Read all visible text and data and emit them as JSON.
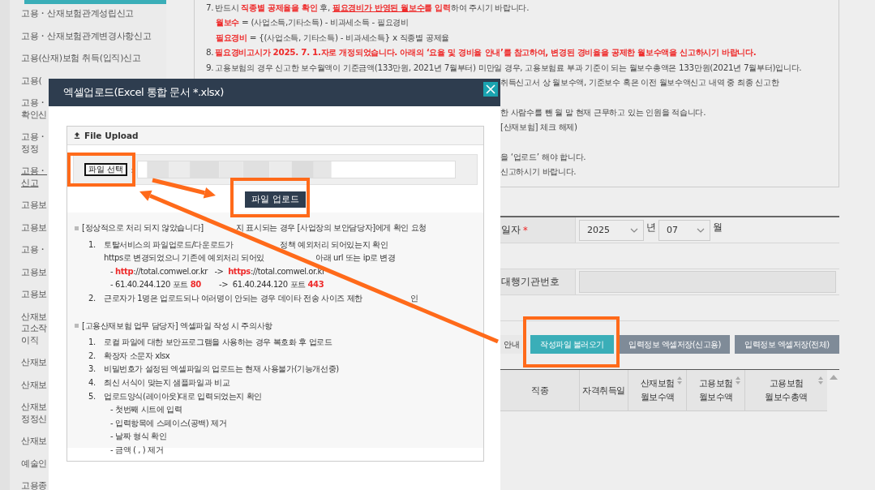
{
  "sidebar": {
    "items": [
      {
        "lines": [
          "고용・산재보험관계성립신고"
        ],
        "selected": false
      },
      {
        "lines": [
          "고용・산재보험관계변경사항신고"
        ],
        "selected": false
      },
      {
        "lines": [
          "고용(산재)보험 취득(입직)신고"
        ],
        "selected": false
      },
      {
        "lines": [
          "고용("
        ],
        "selected": false
      },
      {
        "lines": [
          "고용・",
          "확인신"
        ],
        "selected": false
      },
      {
        "lines": [
          "고용・",
          "정정"
        ],
        "selected": false
      },
      {
        "lines": [
          "고용・",
          "신고"
        ],
        "selected": true
      },
      {
        "lines": [
          "고용보"
        ],
        "selected": false
      },
      {
        "lines": [
          "고용보"
        ],
        "selected": false
      },
      {
        "lines": [
          "고용・"
        ],
        "selected": false
      },
      {
        "lines": [
          "고용보"
        ],
        "selected": false
      },
      {
        "lines": [
          "고용보"
        ],
        "selected": false
      },
      {
        "lines": [
          "산재보",
          "고소작",
          "이직"
        ],
        "selected": false
      },
      {
        "lines": [
          "산재보"
        ],
        "selected": false
      },
      {
        "lines": [
          "산재보"
        ],
        "selected": false
      },
      {
        "lines": [
          "산재보",
          "정정신"
        ],
        "selected": false
      },
      {
        "lines": [
          "산재보"
        ],
        "selected": false
      },
      {
        "lines": [
          "예술인"
        ],
        "selected": false
      },
      {
        "lines": [
          "고용종"
        ],
        "selected": false
      }
    ]
  },
  "notes": [
    {
      "lines": [
        {
          "kind": "item",
          "number": "7.",
          "segments": [
            {
              "text": "반드시 "
            },
            {
              "text": "직종별 공제율을 확인",
              "color": "#ee2b2b"
            },
            {
              "text": " 후, "
            },
            {
              "text": "필요경비가 반영된 월보수",
              "color": "#ee2b2b",
              "underline": true
            },
            {
              "text": "를 입력",
              "color": "#ee2b2b"
            },
            {
              "text": "하여 주시기 바랍니다."
            }
          ]
        },
        {
          "kind": "continuation",
          "segments": [
            {
              "text": "월보수",
              "color": "#ee2b2b"
            },
            {
              "text": " = (사업소득,기타소득) - 비과세소득 - 필요경비"
            }
          ]
        },
        {
          "kind": "continuation",
          "segments": [
            {
              "text": "필요경비",
              "color": "#ee2b2b"
            },
            {
              "text": " = {(사업소득, 기타소득) - 비과세소득} x 직종별 공제율"
            }
          ]
        },
        {
          "kind": "item",
          "number": "8.",
          "segments": [
            {
              "text": "필요경비고시가 2025. 7. 1.자로 개정되었습니다. 아래의 ‘요율 및 경비율 안내’를 참고하여, 변경된 경비율을 공제한 월보수액을 신고하시기 바랍니다.",
              "color": "#ee2b2b"
            }
          ]
        },
        {
          "kind": "item",
          "number": "9.",
          "segments": [
            {
              "text": "고용보험의 경우 신고한 보수월액이 기준금액(133만원, 2021년 7월부터) 미만일 경우, 고용보험료 부과 기준이 되는 월보수총액은 133만원(2021년 7월부터)입니다."
            }
          ]
        },
        {
          "kind": "fragment",
          "segments": [
            {
              "text": "취득신고서 상 월보수액, 기준보수 혹은 이전 월보수액신고 내역 중 최종 신고한"
            }
          ]
        }
      ]
    },
    {
      "lines": [
        {
          "kind": "fragment",
          "segments": [
            {
              "text": "한 사람수를 뺀 월 말 현재 근무하고 있는 인원을 적습니다."
            }
          ]
        },
        {
          "kind": "fragment",
          "segments": [
            {
              "text": "[산재보험] 체크 해제)"
            }
          ]
        }
      ]
    },
    {
      "lines": [
        {
          "kind": "fragment",
          "segments": [
            {
              "text": "을 ‘업로드’ 해야 합니다."
            }
          ]
        },
        {
          "kind": "fragment",
          "segments": [
            {
              "text": "신고하시기 바랍니다."
            }
          ]
        }
      ]
    }
  ],
  "form": {
    "date_row": {
      "label": "일자",
      "required_mark": "*",
      "year": "2025",
      "year_unit": "년",
      "month": "07",
      "month_unit": "월"
    },
    "agency_row": {
      "label": "대행기관번호",
      "disabled": true
    }
  },
  "buttons": [
    {
      "label": "안내",
      "kind": "plain"
    },
    {
      "label": "작성파일 불러오기",
      "kind": "primary"
    },
    {
      "label": "입력정보 엑셀저장(신고용)",
      "kind": "secondary"
    },
    {
      "label": "입력정보 엑셀저장(전체)",
      "kind": "secondary"
    }
  ],
  "table": {
    "columns": [
      {
        "lines": [
          "직종"
        ],
        "sortable": false
      },
      {
        "lines": [
          "자격취득일"
        ],
        "sortable": false
      },
      {
        "lines": [
          "산재보험",
          "월보수액"
        ],
        "sortable": true
      },
      {
        "lines": [
          "고용보험",
          "월보수액"
        ],
        "sortable": true
      },
      {
        "lines": [
          "고용보험",
          "월보수총액"
        ],
        "sortable": true
      }
    ]
  },
  "modal": {
    "title": "엑셀업로드(Excel 통합 문서 *.xlsx)",
    "panel_title": "File Upload",
    "file_button": "파일 선택",
    "separator": ":",
    "upload_button": "파일 업로드",
    "sections": [
      {
        "heading_parts": [
          "[정상적으로 처리 되지 않았습니다]",
          "지 표시되는 경우 [사업장의 보안담당자]에게 확인 요청"
        ],
        "items": [
          {
            "number": "1.",
            "text_parts": [
              "토탈서비스의 파일업로드/다운로드가",
              "정책 예외처리 되어있는지 확인"
            ],
            "sublines": [
              {
                "kind": "continuation",
                "parts": [
                  "https로 변경되었으니 기존에 예외처리 되어있",
                  "아래 url 또는 ip로 변경"
                ]
              },
              {
                "kind": "detail",
                "segments": [
                  {
                    "text": "- "
                  },
                  {
                    "text": "http",
                    "color": "#ee2b2b"
                  },
                  {
                    "text": "://total.comwel.or.kr   ->  "
                  },
                  {
                    "text": "https",
                    "color": "#ee2b2b"
                  },
                  {
                    "text": "://total.comwel.or.kr"
                  }
                ]
              },
              {
                "kind": "detail",
                "segments": [
                  {
                    "text": "- 61.40.244.120 포트 "
                  },
                  {
                    "text": "80",
                    "color": "#ee2b2b"
                  },
                  {
                    "text": "        ->  61.40.244.120 포트 "
                  },
                  {
                    "text": "443",
                    "color": "#ee2b2b"
                  }
                ]
              }
            ]
          },
          {
            "number": "2.",
            "text_parts": [
              "근로자가 1명은 업로드되나 여러명이 안되는 경우 데이타 전송 사이즈 제한",
              "인"
            ]
          }
        ]
      },
      {
        "heading_parts": [
          "[고용산재보험 업무 담당자] 엑셀파일 작성 시 주의사항"
        ],
        "items": [
          {
            "number": "1.",
            "text_parts": [
              "로컬 파일에 대한 보안프로그램을 사용하는 경우 복호화 후 업로드"
            ]
          },
          {
            "number": "2.",
            "text_parts": [
              "확장자 소문자 xlsx"
            ]
          },
          {
            "number": "3.",
            "text_parts": [
              "비밀번호가 설정된 엑셀파일의 업로드는 현재 사용불가(기능개선중)"
            ]
          },
          {
            "number": "4.",
            "text_parts": [
              "최신 서식이 맞는지 샘플파일과 비교"
            ]
          },
          {
            "number": "5.",
            "text_parts": [
              "업로드양식(레이아웃)대로 입력되었는지 확인"
            ],
            "sublines": [
              {
                "kind": "detail",
                "segments": [
                  {
                    "text": "- 첫번째 시트에 입력"
                  }
                ]
              },
              {
                "kind": "detail",
                "segments": [
                  {
                    "text": "- 입력항목에 스페이스(공백) 제거"
                  }
                ]
              },
              {
                "kind": "detail",
                "segments": [
                  {
                    "text": "- 날짜 형식 확인"
                  }
                ]
              },
              {
                "kind": "detail",
                "segments": [
                  {
                    "text": "- 금액 ( , ) 제거"
                  }
                ]
              }
            ]
          }
        ]
      }
    ]
  }
}
